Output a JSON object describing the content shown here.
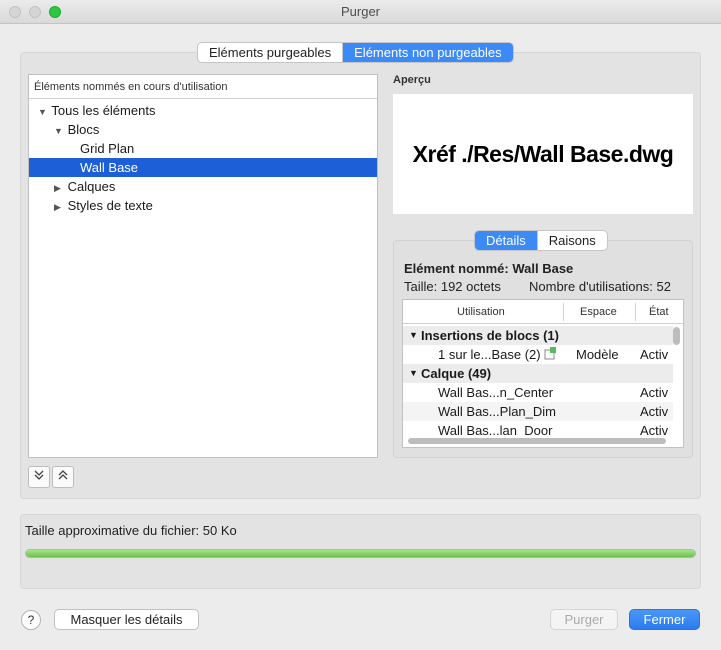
{
  "window": {
    "title": "Purger"
  },
  "tabs": {
    "purgeable": "Eléments purgeables",
    "non_purgeable": "Eléments non purgeables"
  },
  "tree": {
    "header": "Éléments nommés en cours d'utilisation",
    "all": "Tous les éléments",
    "blocs": "Blocs",
    "grid_plan": "Grid Plan",
    "wall_base": "Wall Base",
    "calques": "Calques",
    "styles": "Styles de texte"
  },
  "preview": {
    "label": "Aperçu",
    "text": "Xréf ./Res/Wall Base.dwg"
  },
  "detail_tabs": {
    "details": "Détails",
    "raisons": "Raisons"
  },
  "info": {
    "name": "Elément nommé: Wall Base",
    "size": "Taille: 192 octets",
    "uses": "Nombre d'utilisations: 52"
  },
  "table": {
    "columns": [
      "Utilisation",
      "Espace",
      "État"
    ],
    "group1": "Insertions de blocs (1)",
    "row1": {
      "use": "1 sur le...Base (2)",
      "space": "Modèle",
      "state": "Activ"
    },
    "group2": "Calque (49)",
    "row2": {
      "use": "Wall Bas...n_Center",
      "state": "Activ"
    },
    "row3": {
      "use": "Wall Bas...Plan_Dim",
      "state": "Activ"
    },
    "row4": {
      "use": "Wall Bas...lan_Door",
      "state": "Activ"
    }
  },
  "file_size": {
    "label": "Taille approximative du fichier: 50 Ko",
    "progress": 1.0
  },
  "buttons": {
    "help": "?",
    "hide": "Masquer les détails",
    "purge": "Purger",
    "close": "Fermer"
  },
  "icons": {
    "expand": "expand-all-icon",
    "collapse": "collapse-all-icon",
    "block_ref": "block-reference-icon"
  }
}
